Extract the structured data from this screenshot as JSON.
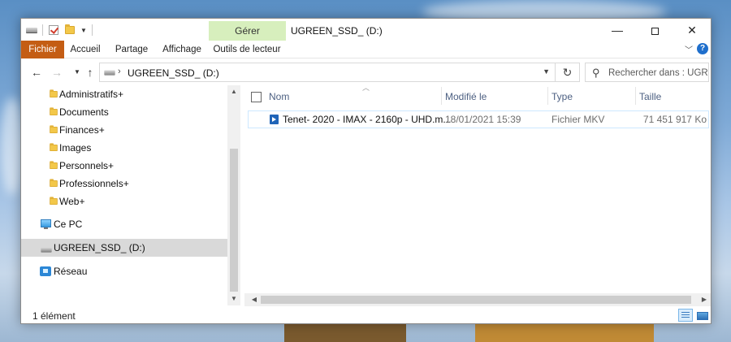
{
  "window": {
    "title": "UGREEN_SSD_ (D:)",
    "contextual_tab": "Gérer",
    "controls": {
      "minimize": "—",
      "close": "✕"
    }
  },
  "ribbon": {
    "tabs": [
      "Fichier",
      "Accueil",
      "Partage",
      "Affichage",
      "Outils de lecteur"
    ],
    "collapse_icon": "chevron-down-icon",
    "help": "?"
  },
  "address": {
    "path": "UGREEN_SSD_ (D:)",
    "search_placeholder": "Rechercher dans : UGR..."
  },
  "nav_pane": {
    "folders": [
      "Administratifs+",
      "Documents",
      "Finances+",
      "Images",
      "Personnels+",
      "Professionnels+",
      "Web+"
    ],
    "this_pc": "Ce PC",
    "drive": "UGREEN_SSD_ (D:)",
    "network": "Réseau"
  },
  "columns": {
    "name": "Nom",
    "modified": "Modifié le",
    "type": "Type",
    "size": "Taille"
  },
  "files": [
    {
      "name": "Tenet- 2020 - IMAX - 2160p - UHD.m...",
      "modified": "18/01/2021 15:39",
      "type": "Fichier MKV",
      "size": "71 451 917 Ko"
    }
  ],
  "status": {
    "count": "1 élément"
  },
  "colors": {
    "file_tab": "#c45d14",
    "contextual_tab": "#d7efbd",
    "selection": "#d9d9d9",
    "header_text": "#4d6082"
  }
}
